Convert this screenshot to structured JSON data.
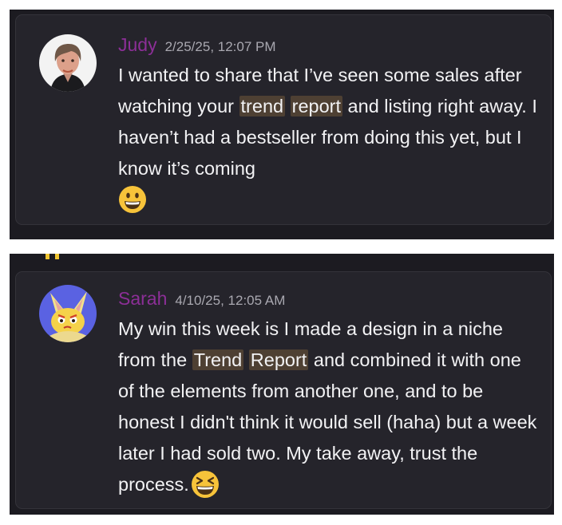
{
  "messages": [
    {
      "username": "Judy",
      "timestamp": "2/25/25, 12:07 PM",
      "avatar": "profile-photo",
      "text_before": "I wanted to share that I’ve seen some sales after watching your ",
      "highlight_1": "trend",
      "highlight_2": "report",
      "text_after": " and listing right away. I haven’t had a bestseller from doing this yet, but I know it’s coming",
      "emoji": "grinning-face-emoji"
    },
    {
      "username": "Sarah",
      "timestamp": "4/10/25, 12:05 AM",
      "avatar": "cartoon-bunny-avatar",
      "text_before": "My win this week is I made a design in a niche from the ",
      "highlight_1": "Trend",
      "highlight_2": "Report",
      "text_after": " and combined it with one of the elements from another one, and to be honest I didn't think it would sell (haha) but a week later I had sold two. My take away, trust the process.",
      "emoji": "laughing-squint-emoji"
    }
  ],
  "colors": {
    "background": "#1c1b21",
    "card": "#25242b",
    "username": "#8c2f97",
    "timestamp": "#a9a8b0",
    "text": "#f2f2f4",
    "highlight": "#4e4033",
    "emoji": "#f7c33a"
  }
}
